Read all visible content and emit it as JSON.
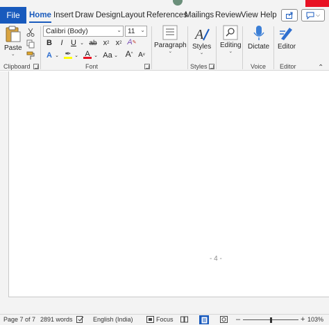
{
  "colors": {
    "accent": "#185abd",
    "close": "#e81123"
  },
  "tabs": {
    "file": "File",
    "items": [
      {
        "label": "Home",
        "active": true
      },
      {
        "label": "Insert"
      },
      {
        "label": "Draw"
      },
      {
        "label": "Design"
      },
      {
        "label": "Layout"
      },
      {
        "label": "References"
      },
      {
        "label": "Mailings"
      },
      {
        "label": "Review"
      },
      {
        "label": "View"
      },
      {
        "label": "Help"
      }
    ]
  },
  "clipboard": {
    "paste_label": "Paste",
    "group_label": "Clipboard"
  },
  "font": {
    "font_name": "Calibri (Body)",
    "font_size": "11",
    "bold": "B",
    "italic": "I",
    "underline": "U",
    "strikethrough": "ab",
    "subscript": "x",
    "superscript": "x",
    "change_case": "Aa",
    "grow": "A",
    "shrink": "A",
    "font_color": "A",
    "text_effects": "A",
    "clear_format": "A",
    "group_label": "Font"
  },
  "paragraph": {
    "label": "Paragraph"
  },
  "styles": {
    "label": "Styles",
    "group_label": "Styles"
  },
  "editing": {
    "label": "Editing"
  },
  "voice": {
    "dictate_label": "Dictate",
    "group_label": "Voice"
  },
  "editor": {
    "label": "Editor",
    "group_label": "Editor"
  },
  "document": {
    "page_number": "- 4 -"
  },
  "status": {
    "page": "Page 7 of 7",
    "words": "2891 words",
    "language": "English (India)",
    "focus": "Focus",
    "zoom_level": 103,
    "zoom": "103%"
  }
}
